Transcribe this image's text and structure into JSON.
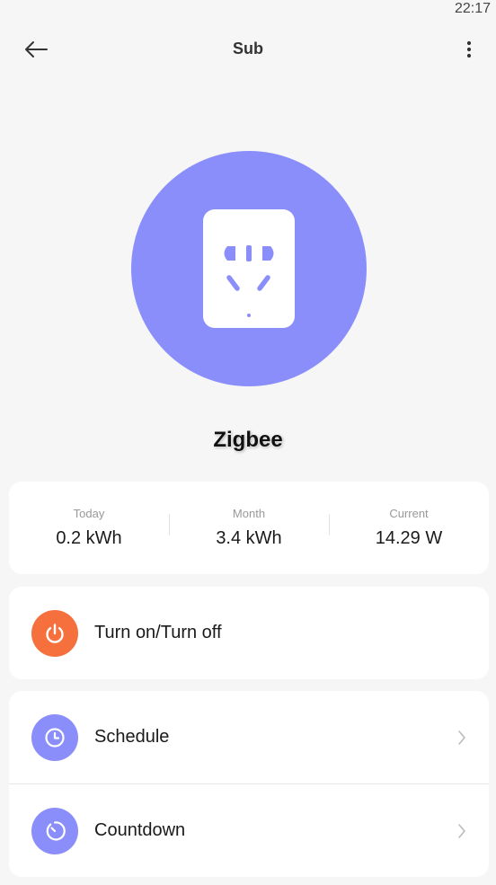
{
  "status_bar": {
    "time": "22:17"
  },
  "header": {
    "title": "Sub",
    "back_icon": "arrow-left-icon",
    "menu_icon": "more-vertical-icon"
  },
  "device": {
    "name": "Zigbee",
    "icon": "power-socket-icon",
    "circle_color": "#8a8efb"
  },
  "energy": [
    {
      "label": "Today",
      "value": "0.2 kWh"
    },
    {
      "label": "Month",
      "value": "3.4 kWh"
    },
    {
      "label": "Current",
      "value": "14.29 W"
    }
  ],
  "power": {
    "label": "Turn on/Turn off",
    "icon": "power-icon",
    "icon_color": "#f5703d"
  },
  "actions": [
    {
      "label": "Schedule",
      "icon": "clock-icon",
      "icon_color": "#8a8efb"
    },
    {
      "label": "Countdown",
      "icon": "timer-icon",
      "icon_color": "#8a8efb"
    }
  ]
}
